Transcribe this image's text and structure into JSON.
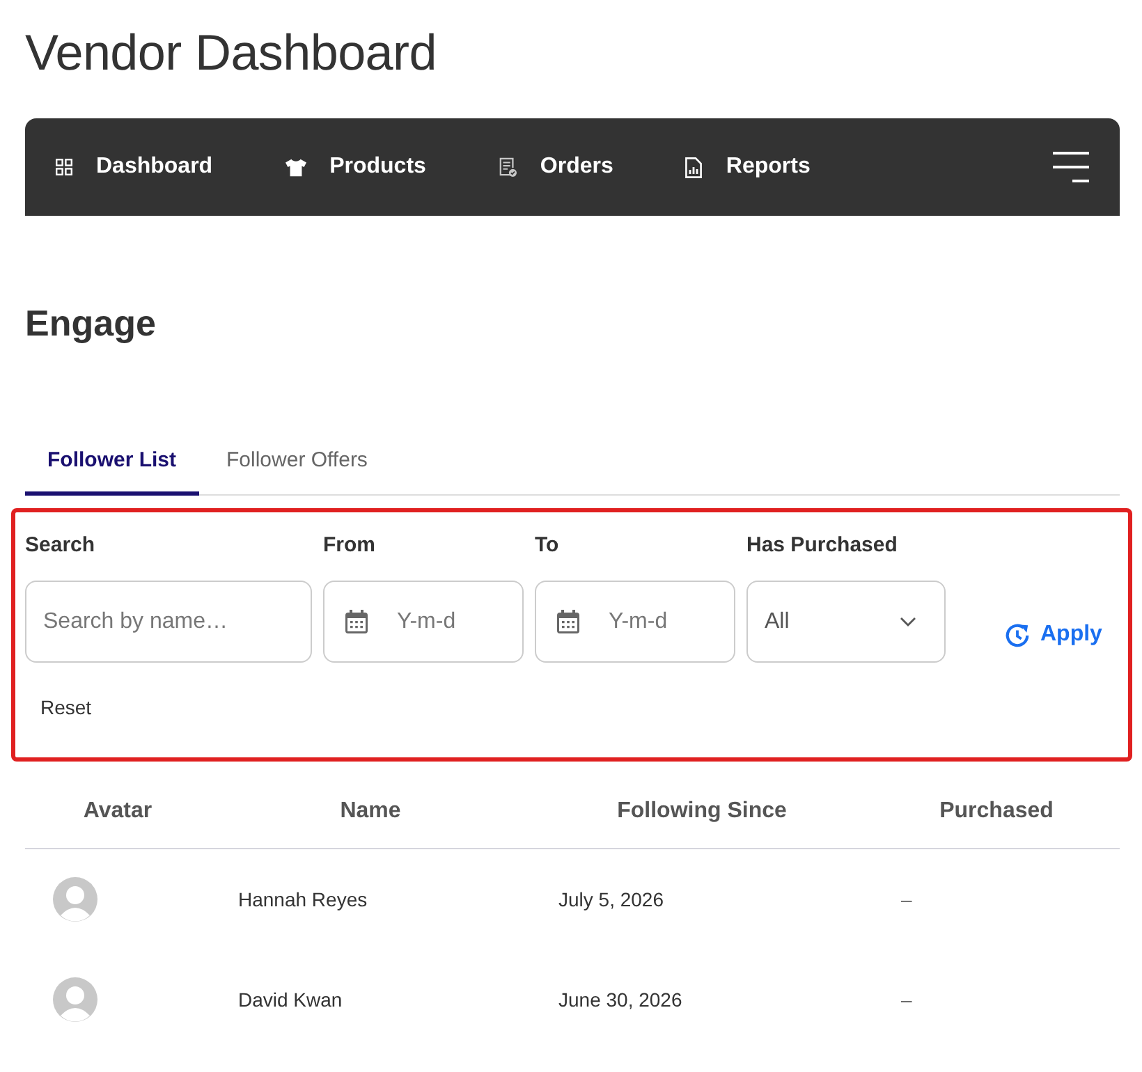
{
  "page_title": "Vendor Dashboard",
  "nav": {
    "items": [
      {
        "label": "Dashboard"
      },
      {
        "label": "Products"
      },
      {
        "label": "Orders"
      },
      {
        "label": "Reports"
      }
    ]
  },
  "section_title": "Engage",
  "tabs": [
    {
      "label": "Follower List",
      "selected": true
    },
    {
      "label": "Follower Offers",
      "selected": false
    }
  ],
  "filters": {
    "highlighted": true,
    "fields": [
      {
        "kind": "text",
        "label": "Search",
        "placeholder": "Search by name…"
      },
      {
        "kind": "date",
        "label": "From",
        "placeholder": "Y-m-d"
      },
      {
        "kind": "date",
        "label": "To",
        "placeholder": "Y-m-d"
      },
      {
        "kind": "select",
        "label": "Has Purchased",
        "value": "All"
      }
    ],
    "apply_button": "Apply",
    "reset_button": "Reset"
  },
  "table": {
    "columns": [
      "Avatar",
      "Name",
      "Following Since",
      "Purchased"
    ],
    "rows": [
      {
        "name": "Hannah Reyes",
        "following_since": "July 5, 2026",
        "purchased": "–"
      },
      {
        "name": "David Kwan",
        "following_since": "June 30, 2026",
        "purchased": "–"
      }
    ]
  }
}
